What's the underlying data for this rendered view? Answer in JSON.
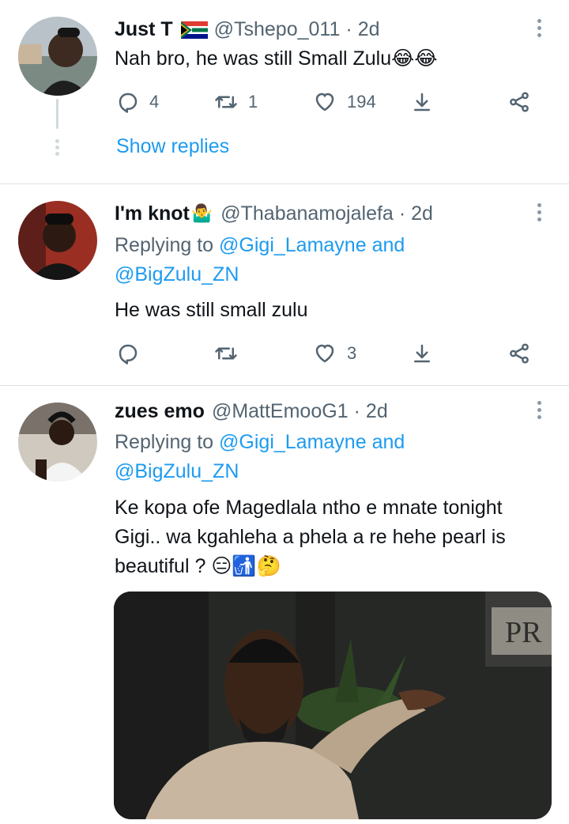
{
  "tweets": [
    {
      "name": "Just T",
      "name_emoji": "🇿🇦",
      "handle": "@Tshepo_011",
      "separator": "·",
      "time": "2d",
      "text": "Nah bro, he was still Small Zulu😂😂",
      "replies": "4",
      "retweets": "1",
      "likes": "194",
      "show_replies": "Show replies"
    },
    {
      "name": "I'm knot",
      "name_emoji": "🤷‍♂️",
      "handle": "@Thabanamojalefa",
      "separator": "·",
      "time": "2d",
      "replying_prefix": "Replying to",
      "replying_user1": "@Gigi_Lamayne",
      "replying_and": "and",
      "replying_user2": "@BigZulu_ZN",
      "text": "He was still small zulu",
      "replies": "",
      "retweets": "",
      "likes": "3"
    },
    {
      "name": "zues emo",
      "handle": "@MattEmooG1",
      "separator": "·",
      "time": "2d",
      "replying_prefix": "Replying to",
      "replying_user1": "@Gigi_Lamayne",
      "replying_and": "and",
      "replying_user2": "@BigZulu_ZN",
      "text_line1": "Ke kopa ofe Magedlala ntho e mnate tonight",
      "text_line2": "Gigi.. wa kgahleha a phela a re hehe pearl is",
      "text_line3": "beautiful ? 😑🚮🤔",
      "media_sign_text": "PR"
    }
  ],
  "icons": {
    "reply": "reply-icon",
    "retweet": "retweet-icon",
    "like": "heart-icon",
    "bookmark": "bookmark-icon",
    "share": "share-icon",
    "more": "more-options-icon"
  },
  "colors": {
    "link": "#1d9bf0",
    "secondary_text": "#536471",
    "divider": "#dfe3e6"
  }
}
